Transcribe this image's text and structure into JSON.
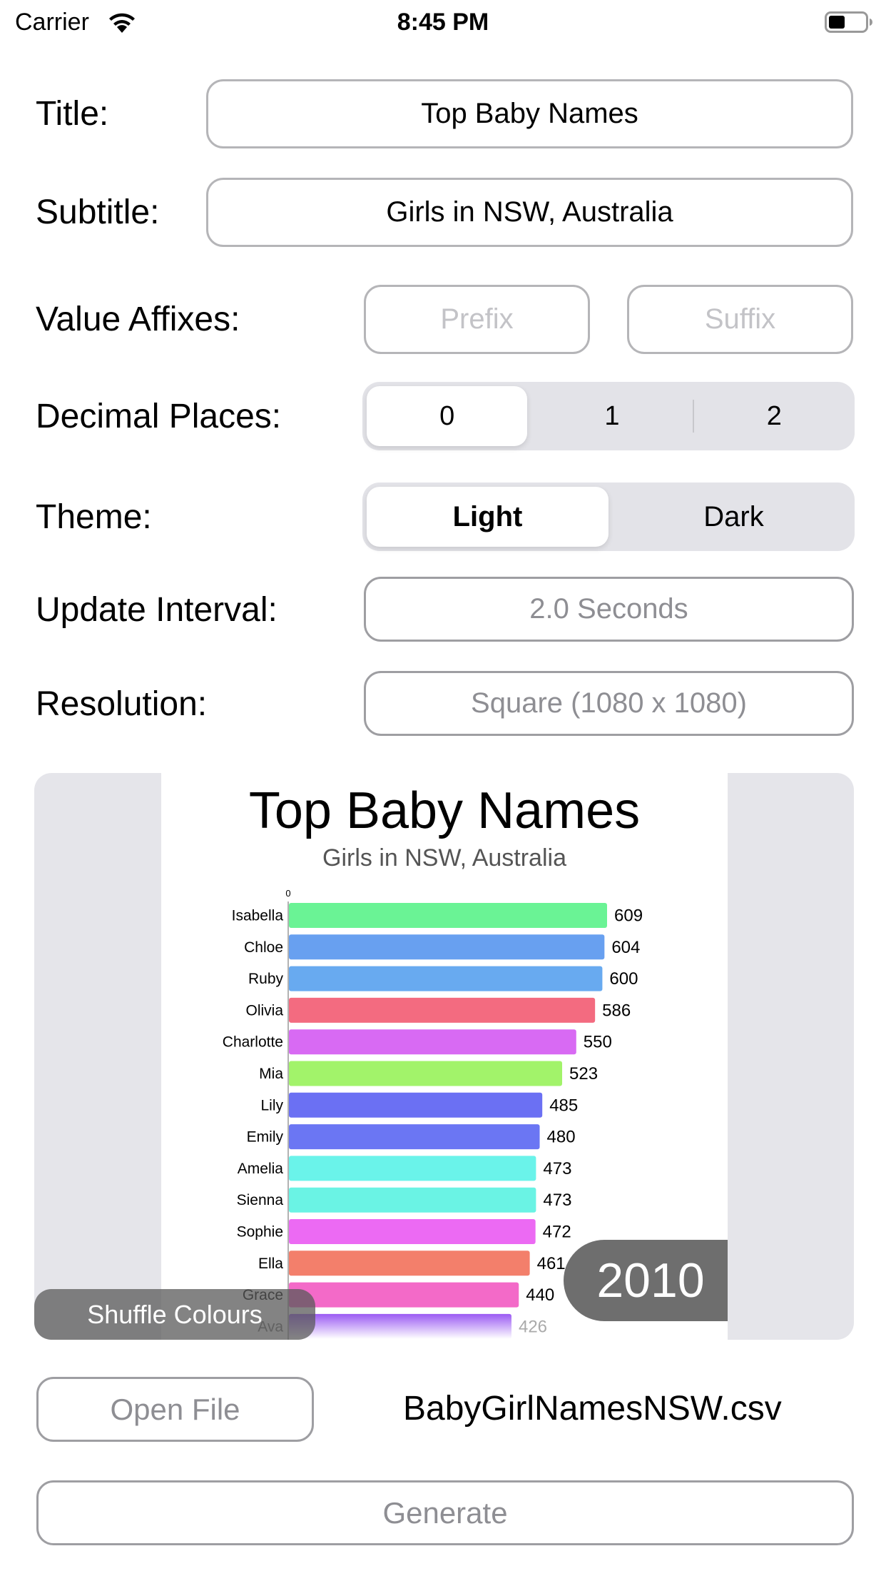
{
  "status_bar": {
    "carrier": "Carrier",
    "time": "8:45 PM",
    "icons": [
      "wifi-icon",
      "battery-icon"
    ]
  },
  "form": {
    "title": {
      "label": "Title:",
      "value": "Top Baby Names"
    },
    "subtitle": {
      "label": "Subtitle:",
      "value": "Girls in NSW, Australia"
    },
    "value_affixes": {
      "label": "Value Affixes:",
      "prefix_placeholder": "Prefix",
      "suffix_placeholder": "Suffix",
      "prefix_value": "",
      "suffix_value": ""
    },
    "decimal_places": {
      "label": "Decimal Places:",
      "options": [
        "0",
        "1",
        "2"
      ],
      "selected": "0"
    },
    "theme": {
      "label": "Theme:",
      "options": [
        "Light",
        "Dark"
      ],
      "selected": "Light"
    },
    "update_interval": {
      "label": "Update Interval:",
      "value": "2.0 Seconds"
    },
    "resolution": {
      "label": "Resolution:",
      "value": "Square (1080 x 1080)"
    }
  },
  "preview": {
    "year": "2010",
    "shuffle_label": "Shuffle Colours"
  },
  "file": {
    "open_label": "Open File",
    "filename": "BabyGirlNamesNSW.csv"
  },
  "generate_label": "Generate",
  "chart_data": {
    "type": "bar",
    "orientation": "horizontal",
    "title": "Top Baby Names",
    "subtitle": "Girls in NSW, Australia",
    "xlabel": "",
    "ylabel": "",
    "x_ticks": [
      "0"
    ],
    "xlim": [
      0,
      680
    ],
    "grid": false,
    "period_label": "2010",
    "categories": [
      "Isabella",
      "Chloe",
      "Ruby",
      "Olivia",
      "Charlotte",
      "Mia",
      "Lily",
      "Emily",
      "Amelia",
      "Sienna",
      "Sophie",
      "Ella",
      "Grace",
      "Ava"
    ],
    "values": [
      609,
      604,
      600,
      586,
      550,
      523,
      485,
      480,
      473,
      473,
      472,
      461,
      440,
      426
    ],
    "colors": [
      "#6af395",
      "#68a0f0",
      "#68aaf0",
      "#f36b80",
      "#d86af3",
      "#a2f36a",
      "#6b70f3",
      "#6b76f3",
      "#6af3ea",
      "#6af3e4",
      "#ec6af3",
      "#f37f6b",
      "#f36ac8",
      "#9b5af3"
    ],
    "fading": [
      false,
      false,
      false,
      false,
      false,
      false,
      false,
      false,
      false,
      false,
      false,
      false,
      false,
      true
    ]
  }
}
